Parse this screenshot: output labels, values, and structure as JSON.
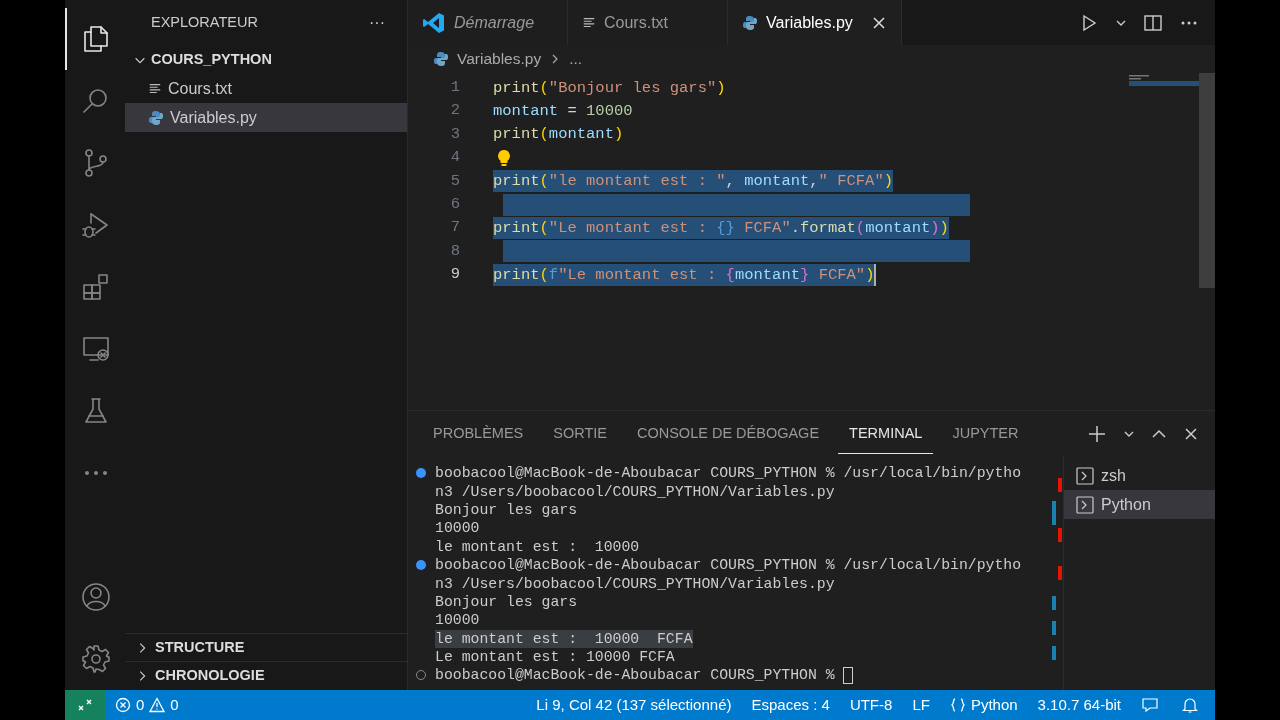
{
  "activity_bar": {
    "items": [
      {
        "selected": true
      },
      {
        "selected": false
      },
      {
        "selected": false
      },
      {
        "selected": false
      },
      {
        "selected": false
      },
      {
        "selected": false
      },
      {
        "selected": false
      },
      {
        "selected": false
      }
    ]
  },
  "sidebar": {
    "title": "EXPLORATEUR",
    "more": "···",
    "folder": {
      "name": "COURS_PYTHON",
      "expanded": true,
      "children": [
        {
          "name": "Cours.txt",
          "kind": "text",
          "selected": false
        },
        {
          "name": "Variables.py",
          "kind": "python",
          "selected": true
        }
      ]
    },
    "sections": [
      {
        "name": "STRUCTURE",
        "expanded": false
      },
      {
        "name": "CHRONOLOGIE",
        "expanded": false
      }
    ]
  },
  "tabs": [
    {
      "label": "Démarrage",
      "kind": "welcome",
      "selected": false,
      "italic": true
    },
    {
      "label": "Cours.txt",
      "kind": "text",
      "selected": false,
      "italic": false
    },
    {
      "label": "Variables.py",
      "kind": "python",
      "selected": true,
      "italic": false
    }
  ],
  "breadcrumb": {
    "file": "Variables.py",
    "rest": "..."
  },
  "editor": {
    "lines": [
      {
        "number": "1",
        "selected": false,
        "current": false,
        "tokens": [
          {
            "text": "print",
            "kind": "function"
          },
          {
            "text": "(",
            "kind": "bracket1"
          },
          {
            "text": "\"Bonjour les gars\"",
            "kind": "string"
          },
          {
            "text": ")",
            "kind": "bracket1"
          }
        ]
      },
      {
        "number": "2",
        "selected": false,
        "current": false,
        "tokens": [
          {
            "text": "montant",
            "kind": "variable"
          },
          {
            "text": " = ",
            "kind": "operator"
          },
          {
            "text": "10000",
            "kind": "number"
          }
        ]
      },
      {
        "number": "3",
        "selected": false,
        "current": false,
        "tokens": [
          {
            "text": "print",
            "kind": "function"
          },
          {
            "text": "(",
            "kind": "bracket1"
          },
          {
            "text": "montant",
            "kind": "variable"
          },
          {
            "text": ")",
            "kind": "bracket1"
          }
        ]
      },
      {
        "number": "4",
        "selected": false,
        "current": false,
        "lightbulb": true
      },
      {
        "number": "5",
        "selected": true,
        "current": false,
        "tokens": [
          {
            "text": "print",
            "kind": "function"
          },
          {
            "text": "(",
            "kind": "bracket1"
          },
          {
            "text": "\"le montant est : \"",
            "kind": "string"
          },
          {
            "text": ", ",
            "kind": "operator"
          },
          {
            "text": "montant",
            "kind": "variable"
          },
          {
            "text": ",",
            "kind": "operator"
          },
          {
            "text": "\" FCFA\"",
            "kind": "string"
          },
          {
            "text": ")",
            "kind": "bracket1"
          }
        ]
      },
      {
        "number": "6",
        "selected": true,
        "current": false
      },
      {
        "number": "7",
        "selected": true,
        "current": false,
        "tokens": [
          {
            "text": "print",
            "kind": "function"
          },
          {
            "text": "(",
            "kind": "bracket1"
          },
          {
            "text": "\"Le montant est : ",
            "kind": "string"
          },
          {
            "text": "{}",
            "kind": "keyword"
          },
          {
            "text": " FCFA\"",
            "kind": "string"
          },
          {
            "text": ".",
            "kind": "operator"
          },
          {
            "text": "format",
            "kind": "function"
          },
          {
            "text": "(",
            "kind": "bracket2"
          },
          {
            "text": "montant",
            "kind": "variable"
          },
          {
            "text": ")",
            "kind": "bracket2"
          },
          {
            "text": ")",
            "kind": "bracket1"
          }
        ]
      },
      {
        "number": "8",
        "selected": true,
        "current": false
      },
      {
        "number": "9",
        "selected": true,
        "current": true,
        "tokens": [
          {
            "text": "print",
            "kind": "function"
          },
          {
            "text": "(",
            "kind": "bracket1"
          },
          {
            "text": "f",
            "kind": "keyword"
          },
          {
            "text": "\"Le montant est : ",
            "kind": "string"
          },
          {
            "text": "{",
            "kind": "bracket2"
          },
          {
            "text": "montant",
            "kind": "variable"
          },
          {
            "text": "}",
            "kind": "bracket2"
          },
          {
            "text": " FCFA\"",
            "kind": "string"
          },
          {
            "text": ")",
            "kind": "bracket1"
          }
        ]
      }
    ]
  },
  "panel": {
    "tabs": [
      {
        "label": "PROBLÈMES",
        "selected": false
      },
      {
        "label": "SORTIE",
        "selected": false
      },
      {
        "label": "CONSOLE DE DÉBOGAGE",
        "selected": false
      },
      {
        "label": "TERMINAL",
        "selected": true
      },
      {
        "label": "JUPYTER",
        "selected": false
      }
    ],
    "terminal": {
      "lines": [
        {
          "text": "boobacool@MacBook-de-Aboubacar COURS_PYTHON % /usr/local/bin/pytho",
          "kind": "prompt",
          "finished": true,
          "highlighted": false
        },
        {
          "text": "n3 /Users/boobacool/COURS_PYTHON/Variables.py",
          "kind": "output",
          "highlighted": false
        },
        {
          "text": "Bonjour les gars",
          "kind": "output",
          "highlighted": false
        },
        {
          "text": "10000",
          "kind": "output",
          "highlighted": false
        },
        {
          "text": "le montant est :  10000",
          "kind": "output",
          "highlighted": false
        },
        {
          "text": "boobacool@MacBook-de-Aboubacar COURS_PYTHON % /usr/local/bin/pytho",
          "kind": "prompt",
          "finished": true,
          "highlighted": false
        },
        {
          "text": "n3 /Users/boobacool/COURS_PYTHON/Variables.py",
          "kind": "output",
          "highlighted": false
        },
        {
          "text": "Bonjour les gars",
          "kind": "output",
          "highlighted": false
        },
        {
          "text": "10000",
          "kind": "output",
          "highlighted": false
        },
        {
          "text": "le montant est :  10000  FCFA",
          "kind": "output",
          "highlighted": true
        },
        {
          "text": "Le montant est : 10000 FCFA",
          "kind": "output",
          "highlighted": false
        },
        {
          "text": "boobacool@MacBook-de-Aboubacar COURS_PYTHON % ",
          "kind": "prompt",
          "finished": false,
          "highlighted": false
        }
      ]
    },
    "terminals": [
      {
        "name": "zsh",
        "selected": false
      },
      {
        "name": "Python",
        "selected": true
      }
    ]
  },
  "status_bar": {
    "errors": "0",
    "warnings": "0",
    "position": "Li 9, Col 42 (137 sélectionné)",
    "spaces": "Espaces : 4",
    "encoding": "UTF-8",
    "eol": "LF",
    "language": "Python",
    "interpreter": "3.10.7 64-bit"
  }
}
